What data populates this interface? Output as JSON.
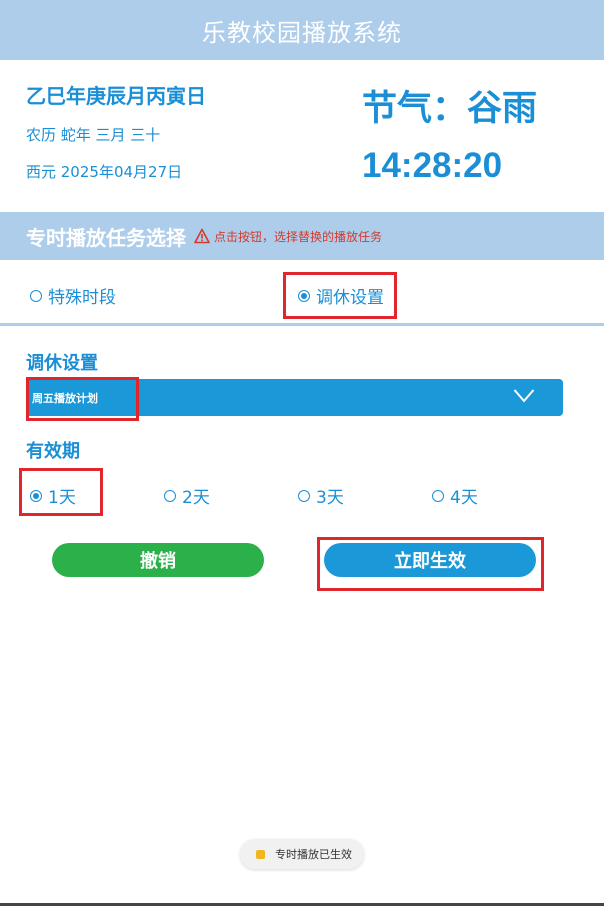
{
  "header": {
    "title": "乐教校园播放系统"
  },
  "calendar": {
    "ganzhi": "乙巳年庚辰月丙寅日",
    "lunar": "农历 蛇年 三月 三十",
    "solar": "西元 2025年04月27日",
    "solar_term": "节气：谷雨",
    "time": "14:28:20"
  },
  "section": {
    "title": "专时播放任务选择",
    "hint": "点击按钮，选择替换的播放任务"
  },
  "modes": [
    {
      "label": "特殊时段",
      "checked": false
    },
    {
      "label": "调休设置",
      "checked": true
    }
  ],
  "adjust": {
    "label": "调休设置",
    "selected": "周五播放计划"
  },
  "validity": {
    "label": "有效期",
    "options": [
      {
        "label": "1天",
        "checked": true
      },
      {
        "label": "2天",
        "checked": false
      },
      {
        "label": "3天",
        "checked": false
      },
      {
        "label": "4天",
        "checked": false
      }
    ]
  },
  "buttons": {
    "cancel": "撤销",
    "apply": "立即生效"
  },
  "toast": {
    "text": "专时播放已生效"
  },
  "colors": {
    "accent": "#1a8fd6",
    "header_bg": "#aecdeb",
    "cancel": "#2bb04a",
    "highlight": "#e0252b"
  }
}
